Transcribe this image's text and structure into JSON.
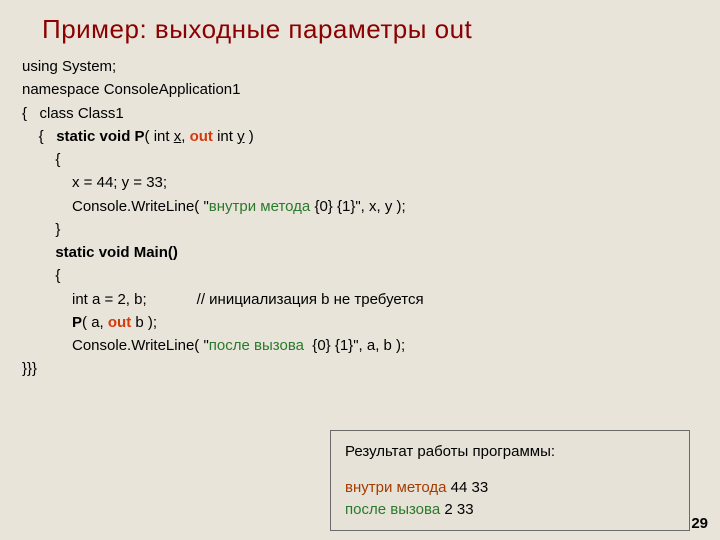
{
  "title": "Пример: выходные параметры out",
  "code": {
    "l1": "using System;",
    "l2": "namespace ConsoleApplication1",
    "l3a": "{   class Class1",
    "l4a": "    {   ",
    "l4b": "static void P",
    "l4c": "( int ",
    "l4x": "x",
    "l4d": ", ",
    "l4out": "out",
    "l4e": " int ",
    "l4y": "y",
    "l4f": " )",
    "l5": "        {",
    "l6": "            x = 44; y = 33;",
    "l7a": "            Console.WriteLine( \"",
    "l7s": "внутри метода",
    "l7b": " {0} {1}\", x, y );",
    "l8": "        }",
    "l9": "        ",
    "l9b": "static void Main()",
    "l10": "        {",
    "l11": "            int a = 2, b;            // инициализация b не требуется",
    "l12": "",
    "l13a": "            ",
    "l13p": "P",
    "l13b": "( a, ",
    "l13out": "out",
    "l13c": " b );",
    "l14a": "            Console.WriteLine( \"",
    "l14s": "после вызова",
    "l14b": "  {0} {1}\", a, b );",
    "l15": "}}}"
  },
  "result": {
    "heading": "Результат работы программы:",
    "line1a": "внутри метода",
    "line1b": " 44 33",
    "line2a": "после вызова",
    "line2b": "  2 33"
  },
  "page": "29"
}
